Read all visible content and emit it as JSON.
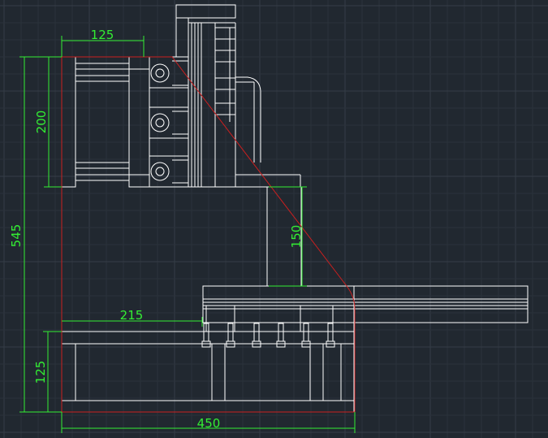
{
  "colors": {
    "background": "#212830",
    "grid_minor": "#2b323b",
    "grid_major": "#353d47",
    "geometry": "#ffffff",
    "dimension": "#33ee33",
    "boundary": "#cc1f1f"
  },
  "dimensions": {
    "top_width": "125",
    "side_height": "200",
    "overall_height": "545",
    "column_height": "150",
    "base_offset": "215",
    "base_height": "125",
    "overall_width": "450"
  }
}
